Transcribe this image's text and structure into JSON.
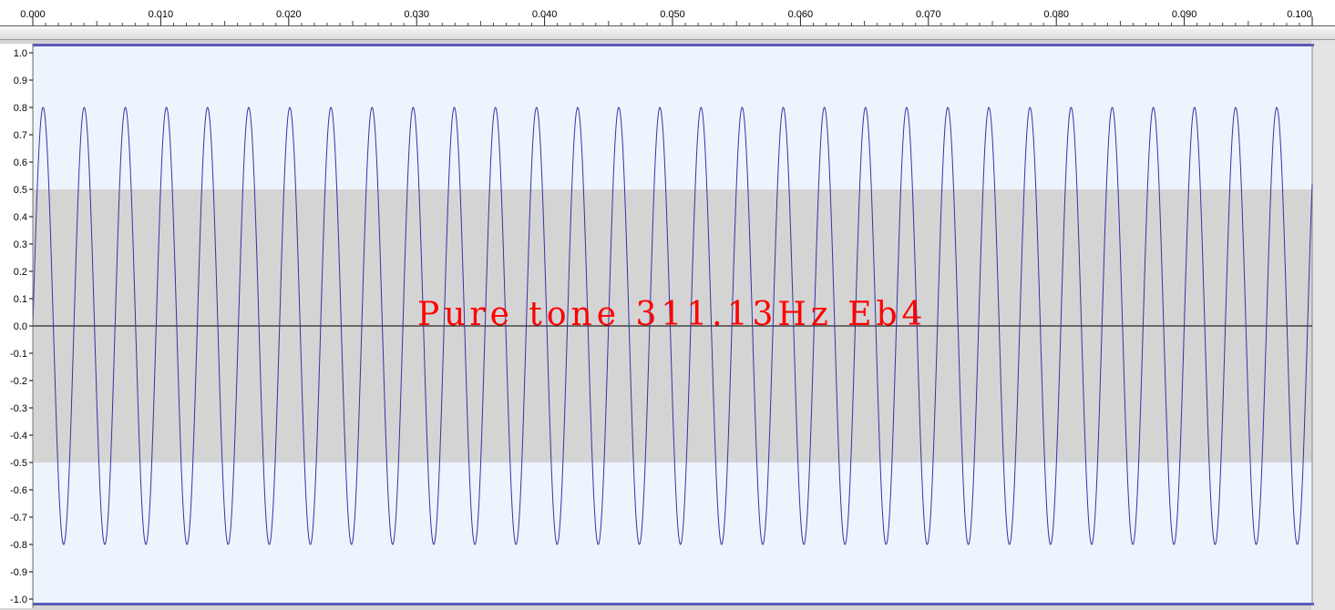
{
  "time_ruler": {
    "ticks": [
      "0.000",
      "0.010",
      "0.020",
      "0.030",
      "0.040",
      "0.050",
      "0.060",
      "0.070",
      "0.080",
      "0.090",
      "0.100"
    ],
    "unit": "seconds"
  },
  "amplitude_ruler": {
    "labels": [
      "1.0",
      "0.9",
      "0.8",
      "0.7",
      "0.6",
      "0.5",
      "0.4",
      "0.3",
      "0.2",
      "0.1",
      "0.0",
      "-0.1",
      "-0.2",
      "-0.3",
      "-0.4",
      "-0.5",
      "-0.6",
      "-0.7",
      "-0.8",
      "-0.9",
      "-1.0"
    ]
  },
  "waveform": {
    "frequency_hz": 311.13,
    "amplitude": 0.8,
    "time_start": 0.0,
    "time_end": 0.1,
    "clip_region": [
      -0.5,
      0.5
    ],
    "color": "#3333a8",
    "background": "#eef4fd",
    "mid_band_color": "#d4d4d4"
  },
  "overlay": {
    "title": "Pure tone 311.13Hz Eb4",
    "color": "#ff0000"
  }
}
